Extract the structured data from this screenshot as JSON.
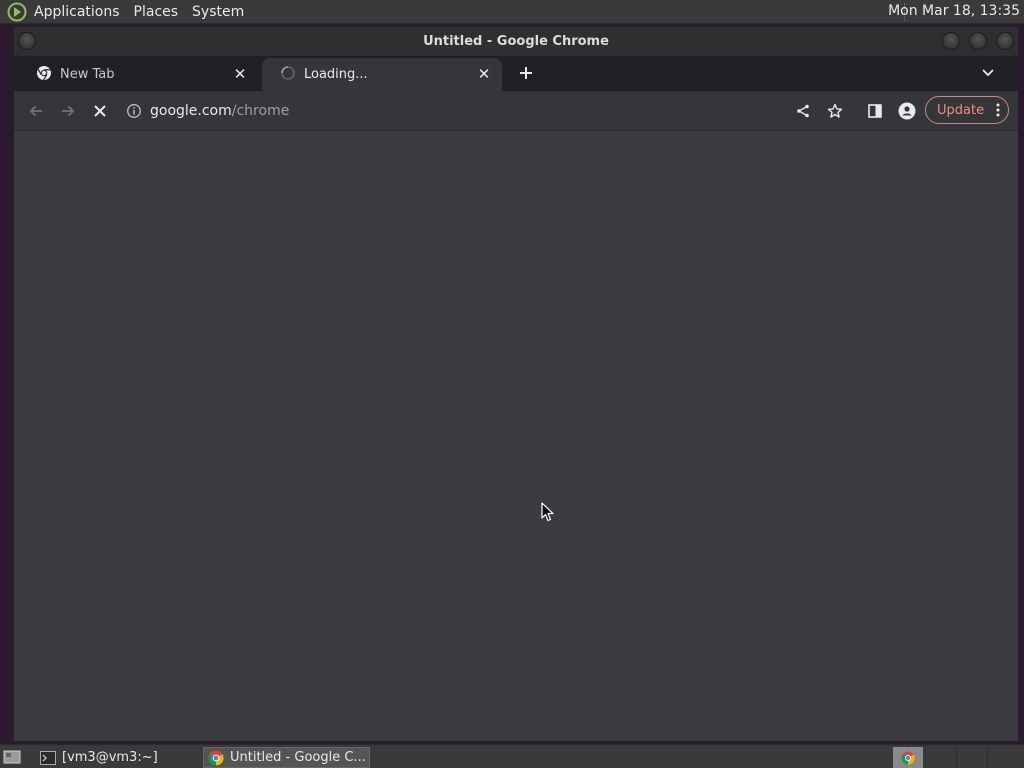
{
  "top_panel": {
    "menus": [
      "Applications",
      "Places",
      "System"
    ],
    "clock": "Mon Mar 18, 13:35"
  },
  "window": {
    "title": "Untitled - Google Chrome"
  },
  "tabs": [
    {
      "title": "New Tab",
      "icon": "chrome-icon",
      "state": "inactive"
    },
    {
      "title": "Loading...",
      "icon": "loading-spinner-icon",
      "state": "active"
    }
  ],
  "toolbar": {
    "url_host": "google.com",
    "url_path": "/chrome",
    "update_label": "Update"
  },
  "taskbar": {
    "tasks": [
      {
        "label": "[vm3@vm3:~]",
        "icon": "terminal-icon"
      },
      {
        "label": "Untitled - Google C...",
        "icon": "chrome-icon"
      }
    ]
  },
  "colors": {
    "update_accent": "#f28b82",
    "content_bg": "#3c3c40",
    "tabstrip_bg": "#202124"
  }
}
